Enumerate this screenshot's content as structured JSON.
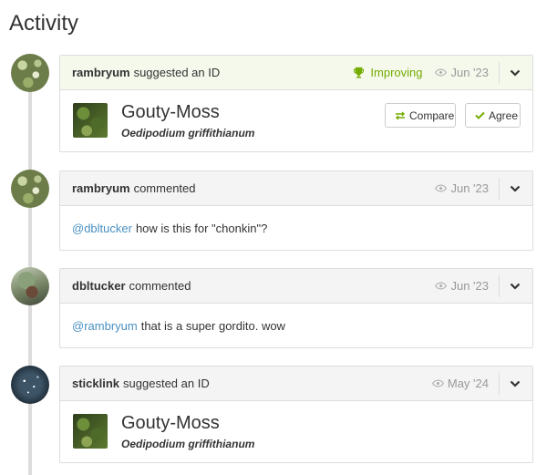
{
  "page": {
    "title": "Activity"
  },
  "colors": {
    "accent_green": "#74ac00",
    "link_blue": "#4a90c2",
    "muted": "#999999"
  },
  "items": [
    {
      "user": "rambryum",
      "action": "suggested an ID",
      "status": "Improving",
      "status_icon": "trophy-icon",
      "date": "Jun '23",
      "taxon": {
        "common_name": "Gouty-Moss",
        "scientific_name": "Oedipodium griffithianum"
      },
      "buttons": {
        "compare": "Compare",
        "agree": "Agree"
      }
    },
    {
      "user": "rambryum",
      "action": "commented",
      "date": "Jun '23",
      "mention": "@dbltucker",
      "text": "how is this for \"chonkin\"?"
    },
    {
      "user": "dbltucker",
      "action": "commented",
      "date": "Jun '23",
      "mention": "@rambryum",
      "text": "that is a super gordito. wow"
    },
    {
      "user": "sticklink",
      "action": "suggested an ID",
      "date": "May '24",
      "taxon": {
        "common_name": "Gouty-Moss",
        "scientific_name": "Oedipodium griffithianum"
      }
    }
  ]
}
